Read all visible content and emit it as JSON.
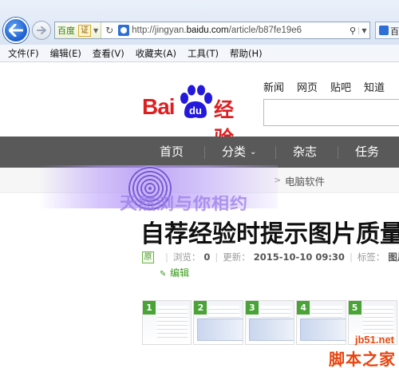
{
  "browser": {
    "site_badge": "百度",
    "cert_badge": "证",
    "url_prefix": "http://jingyan.",
    "url_domain": "baidu.com",
    "url_path": "/article/b87fe19e6",
    "tab_label": "百",
    "menu": [
      "文件(F)",
      "编辑(E)",
      "查看(V)",
      "收藏夹(A)",
      "工具(T)",
      "帮助(H)"
    ]
  },
  "header": {
    "logo_bai": "Bai",
    "logo_du": "du",
    "logo_jingyan": "经验",
    "top_links": [
      "新闻",
      "网页",
      "贴吧",
      "知道"
    ]
  },
  "nav": {
    "items": [
      "首页",
      "分类",
      "杂志",
      "任务"
    ],
    "dropdown_item_index": 1
  },
  "breadcrumb": {
    "arrow": ">",
    "current": "电脑软件"
  },
  "overlay": {
    "text": "天然浏与你相约"
  },
  "article": {
    "title": "自荐经验时提示图片质量",
    "original_badge": "原",
    "views_label": "浏览：",
    "views_value": "0",
    "updated_label": "更新：",
    "updated_value": "2015-10-10 09:30",
    "tags_label": "标签：",
    "tags_value": "图片",
    "edit_label": "编辑"
  },
  "thumbnails": [
    {
      "num": "1"
    },
    {
      "num": "2"
    },
    {
      "num": "3"
    },
    {
      "num": "4"
    },
    {
      "num": "5"
    }
  ],
  "watermark": {
    "site": "jb51.net",
    "name": "脚本之家"
  },
  "colors": {
    "brand_red": "#de1f21",
    "brand_blue": "#2319dc",
    "nav_bg": "#595959",
    "accent_green": "#4aa336",
    "watermark_orange": "#e8440e"
  }
}
